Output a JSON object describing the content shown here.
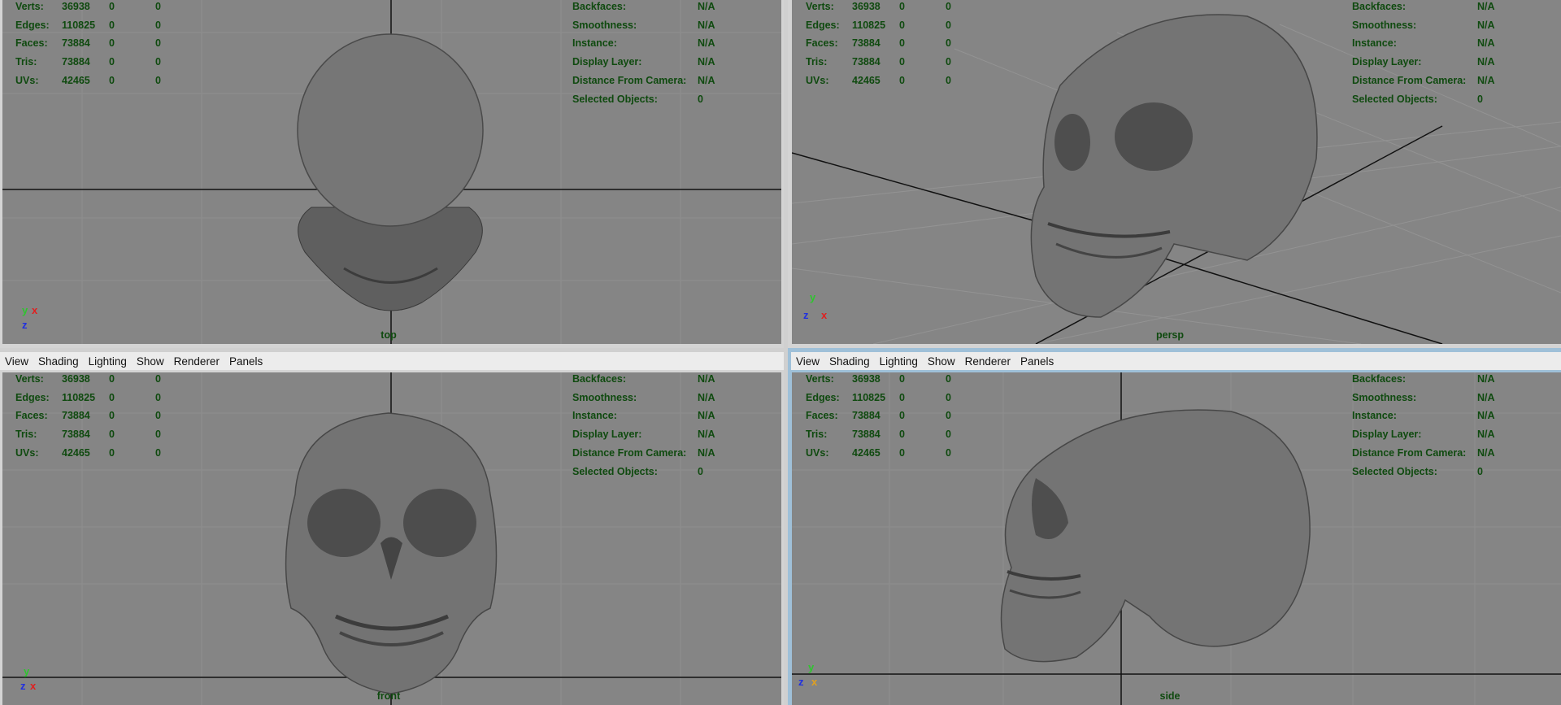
{
  "menu": [
    "View",
    "Shading",
    "Lighting",
    "Show",
    "Renderer",
    "Panels"
  ],
  "stats": {
    "rows": [
      {
        "label": "Verts:",
        "v1": "36938",
        "v2": "0",
        "v3": "0"
      },
      {
        "label": "Edges:",
        "v1": "110825",
        "v2": "0",
        "v3": "0"
      },
      {
        "label": "Faces:",
        "v1": "73884",
        "v2": "0",
        "v3": "0"
      },
      {
        "label": "Tris:",
        "v1": "73884",
        "v2": "0",
        "v3": "0"
      },
      {
        "label": "UVs:",
        "v1": "42465",
        "v2": "0",
        "v3": "0"
      }
    ]
  },
  "info": {
    "rows": [
      {
        "label": "Backfaces:",
        "value": "N/A"
      },
      {
        "label": "Smoothness:",
        "value": "N/A"
      },
      {
        "label": "Instance:",
        "value": "N/A"
      },
      {
        "label": "Display Layer:",
        "value": "N/A"
      },
      {
        "label": "Distance From Camera:",
        "value": "N/A"
      },
      {
        "label": "Selected Objects:",
        "value": "0"
      }
    ]
  },
  "viewports": {
    "top": {
      "camera": "top"
    },
    "persp": {
      "camera": "persp"
    },
    "front": {
      "camera": "front"
    },
    "side": {
      "camera": "side"
    }
  },
  "axes": {
    "x": "x",
    "y": "y",
    "z": "z"
  },
  "colors": {
    "viewport_bg": "#858585",
    "hud_text": "#0f4a0f",
    "active_border": "#9fc0d8"
  }
}
